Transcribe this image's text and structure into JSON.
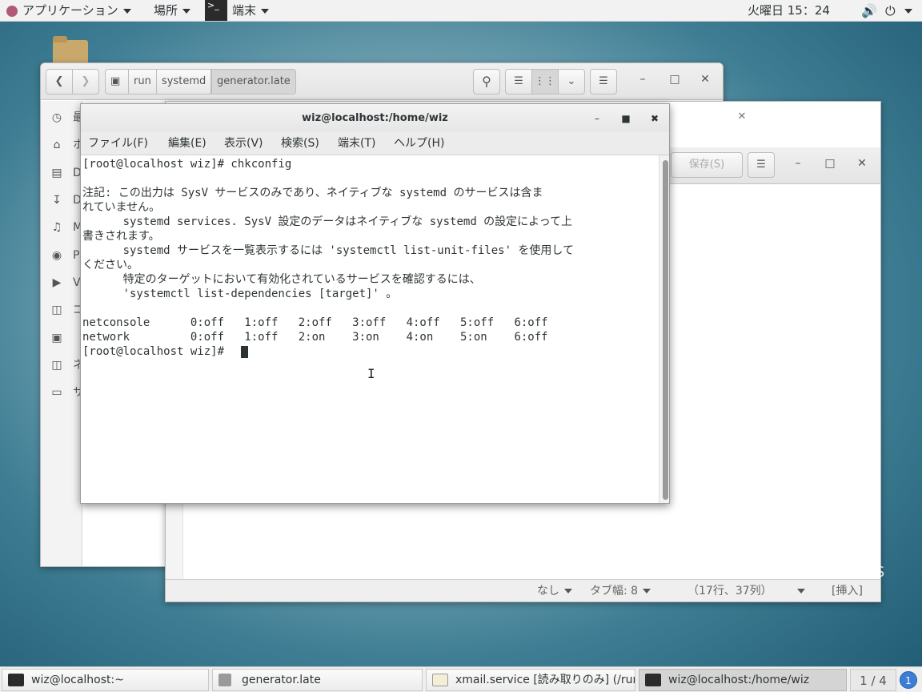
{
  "topbar": {
    "applications": "アプリケーション",
    "places": "場所",
    "app_menu": "端末",
    "clock": "火曜日 15：24"
  },
  "files": {
    "path": [
      "run",
      "systemd",
      "generator.late"
    ],
    "sidebar_labels": [
      "最",
      "ホ",
      "D",
      "D",
      "M",
      "P",
      "V",
      "ゴ",
      "",
      "ネ",
      "サ"
    ]
  },
  "gedit": {
    "save_label": "保存(S)",
    "status": {
      "lang": "なし",
      "tab": "タブ幅: 8",
      "position": "（17行、37列）",
      "mode": "[挿入]"
    }
  },
  "terminal": {
    "title": "wiz@localhost:/home/wiz",
    "menu": [
      "ファイル(F)",
      "編集(E)",
      "表示(V)",
      "検索(S)",
      "端末(T)",
      "ヘルプ(H)"
    ],
    "lines": [
      "[root@localhost wiz]# chkconfig",
      "",
      "注記: この出力は SysV サービスのみであり、ネイティブな systemd のサービスは含ま",
      "れていません。",
      "      systemd services. SysV 設定のデータはネイティブな systemd の設定によって上",
      "書きされます。",
      "      systemd サービスを一覧表示するには 'systemctl list-unit-files' を使用して",
      "ください。",
      "      特定のターゲットにおいて有効化されているサービスを確認するには、",
      "      'systemctl list-dependencies [target]' 。",
      "",
      "netconsole      0:off   1:off   2:off   3:off   4:off   5:off   6:off",
      "network         0:off   1:off   2:on    3:on    4:on    5:on    6:off",
      "[root@localhost wiz]# "
    ]
  },
  "desktop": {
    "watermark": "O S"
  },
  "taskbar": {
    "tasks": [
      "wiz@localhost:~",
      "generator.late",
      "xmail.service [読み取りのみ] (/run…",
      "wiz@localhost:/home/wiz"
    ],
    "workspace": "1 / 4",
    "notifications": "1"
  }
}
